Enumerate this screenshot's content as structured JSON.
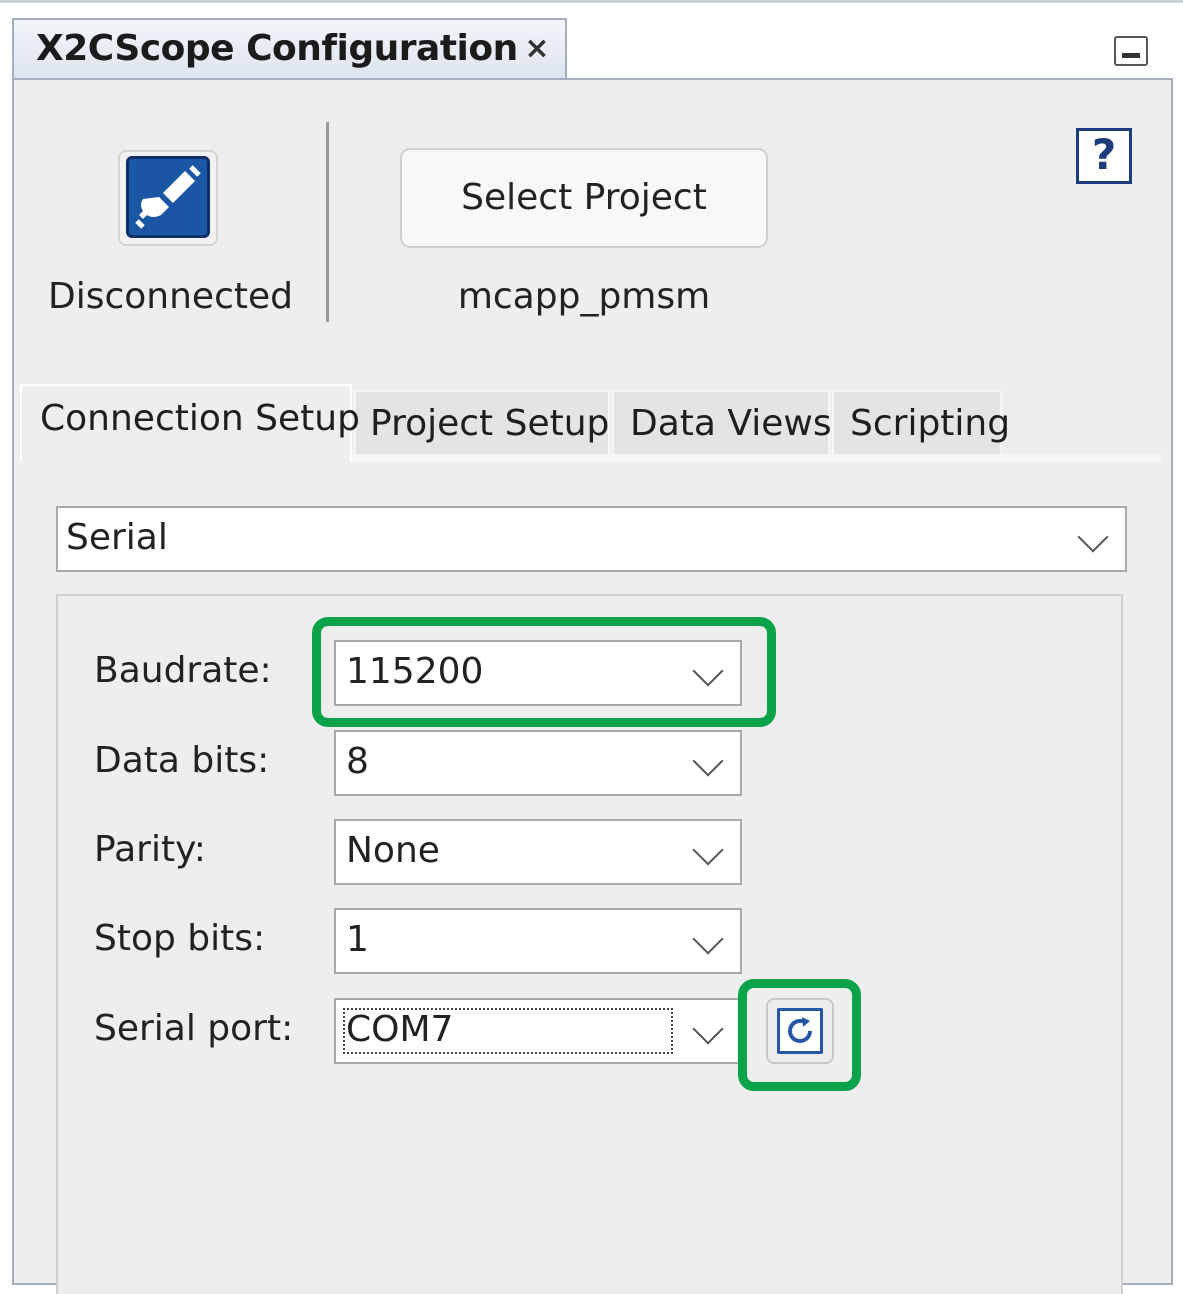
{
  "window": {
    "tab_title": "X2CScope Configuration",
    "close_glyph": "×"
  },
  "status": {
    "connection_label": "Disconnected",
    "connection_icon": "plug-icon"
  },
  "project": {
    "select_button_label": "Select Project",
    "name": "mcapp_pmsm"
  },
  "help": {
    "glyph": "?"
  },
  "tabs": [
    {
      "label": "Connection Setup",
      "active": true
    },
    {
      "label": "Project Setup",
      "active": false
    },
    {
      "label": "Data Views",
      "active": false
    },
    {
      "label": "Scripting",
      "active": false
    }
  ],
  "connection_type": {
    "value": "Serial"
  },
  "serial": {
    "baudrate": {
      "label": "Baudrate:",
      "value": "115200"
    },
    "data_bits": {
      "label": "Data bits:",
      "value": "8"
    },
    "parity": {
      "label": "Parity:",
      "value": "None"
    },
    "stop_bits": {
      "label": "Stop bits:",
      "value": "1"
    },
    "port": {
      "label": "Serial port:",
      "value": "COM7"
    }
  },
  "colors": {
    "highlight": "#0aa34a",
    "accent_blue": "#1b56a5"
  }
}
